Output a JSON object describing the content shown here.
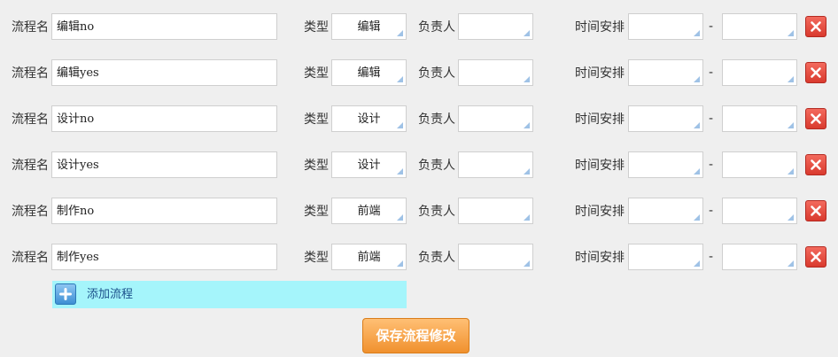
{
  "labels": {
    "name": "流程名",
    "type": "类型",
    "owner": "负责人",
    "schedule": "时间安排",
    "range_sep": "-"
  },
  "rows": [
    {
      "name": "编辑no",
      "type": "编辑",
      "owner": "",
      "start": "",
      "end": ""
    },
    {
      "name": "编辑yes",
      "type": "编辑",
      "owner": "",
      "start": "",
      "end": ""
    },
    {
      "name": "设计no",
      "type": "设计",
      "owner": "",
      "start": "",
      "end": ""
    },
    {
      "name": "设计yes",
      "type": "设计",
      "owner": "",
      "start": "",
      "end": ""
    },
    {
      "name": "制作no",
      "type": "前端",
      "owner": "",
      "start": "",
      "end": ""
    },
    {
      "name": "制作yes",
      "type": "前端",
      "owner": "",
      "start": "",
      "end": ""
    }
  ],
  "add_flow_label": "添加流程",
  "save_label": "保存流程修改",
  "colors": {
    "background": "#efefef",
    "add_bar": "#a5f5fb",
    "delete": "#e04a3e",
    "save": "#f5a04b",
    "corner_mark": "#9fc2e6"
  },
  "icons": {
    "delete": "close-icon",
    "add": "plus-icon",
    "field_corner": "resize-corner-icon"
  }
}
